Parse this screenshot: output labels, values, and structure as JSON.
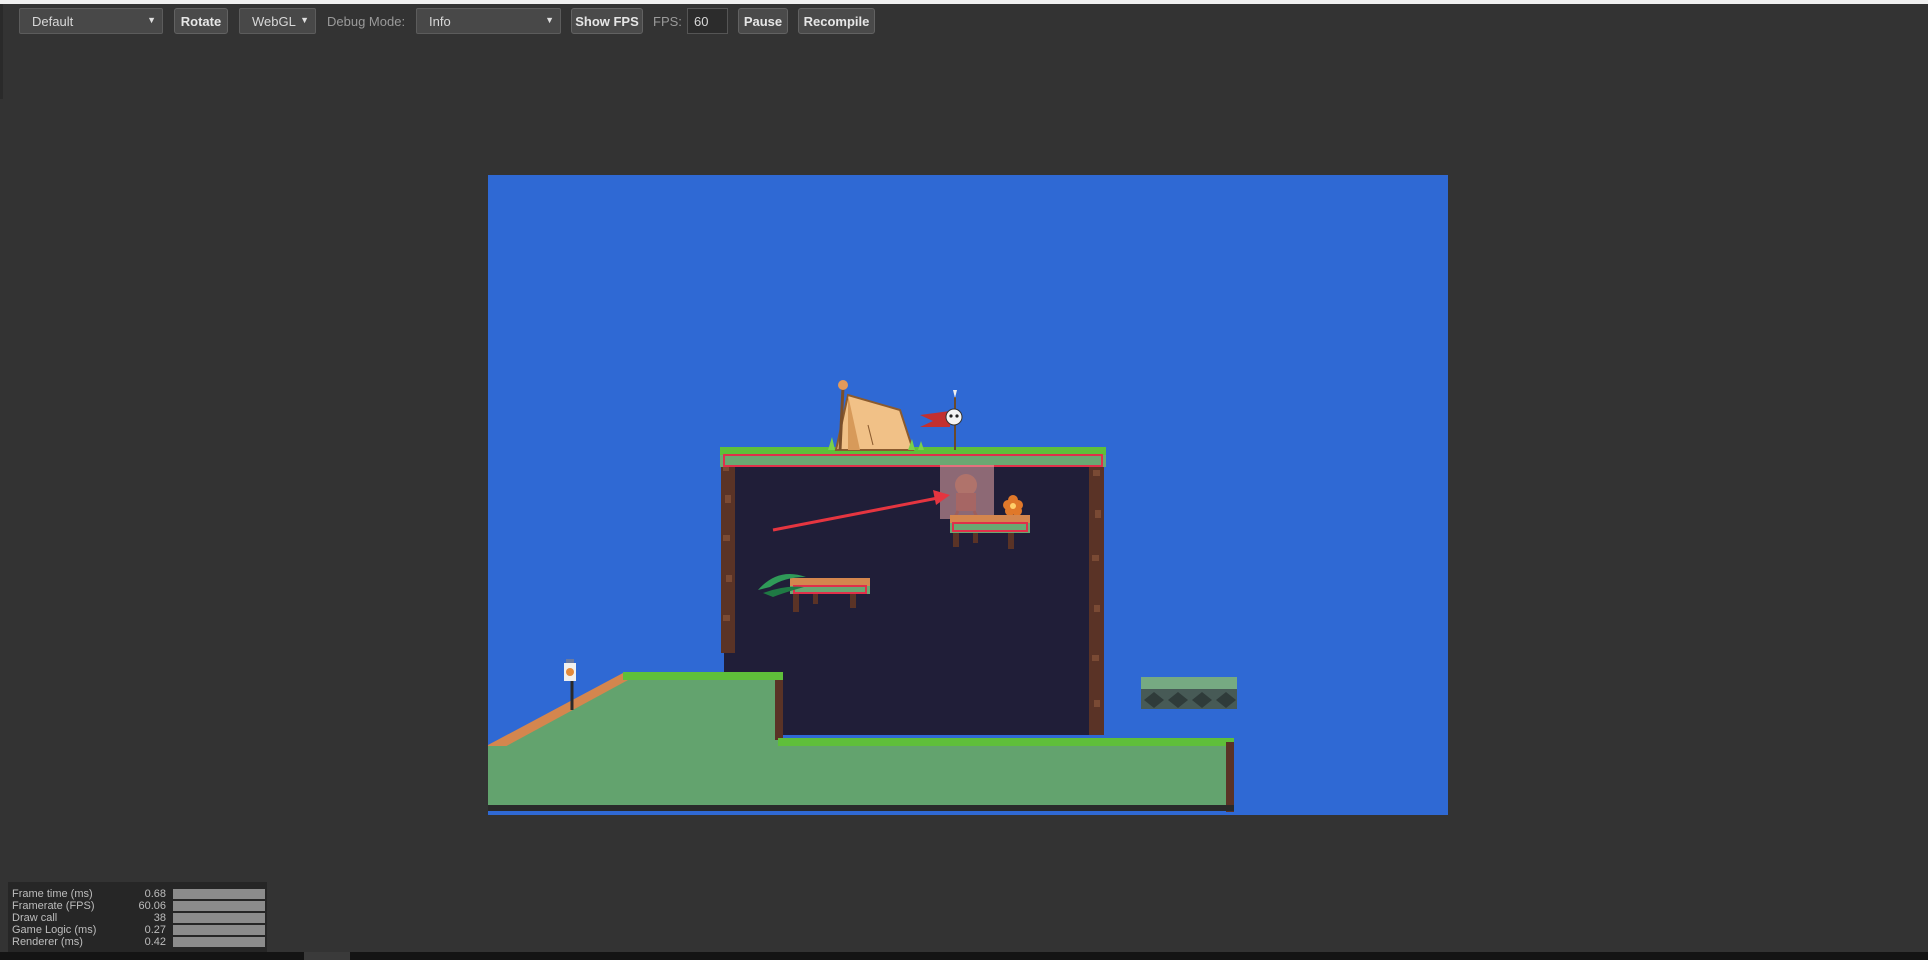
{
  "toolbar": {
    "device_select": "Default",
    "rotate_label": "Rotate",
    "renderer_select": "WebGL",
    "debug_mode_label": "Debug Mode:",
    "debug_mode_select": "Info",
    "show_fps_label": "Show FPS",
    "fps_label": "FPS:",
    "fps_value": "60",
    "pause_label": "Pause",
    "recompile_label": "Recompile"
  },
  "game": {
    "background_color": "#2f69d4",
    "debug_rect_color": "#e0304a"
  },
  "stats": [
    {
      "name": "Frame time (ms)",
      "value": "0.68",
      "fill": 1.0
    },
    {
      "name": "Framerate (FPS)",
      "value": "60.06",
      "fill": 1.0
    },
    {
      "name": "Draw call",
      "value": "38",
      "fill": 1.0
    },
    {
      "name": "Game Logic (ms)",
      "value": "0.27",
      "fill": 1.0
    },
    {
      "name": "Renderer (ms)",
      "value": "0.42",
      "fill": 1.0
    }
  ]
}
